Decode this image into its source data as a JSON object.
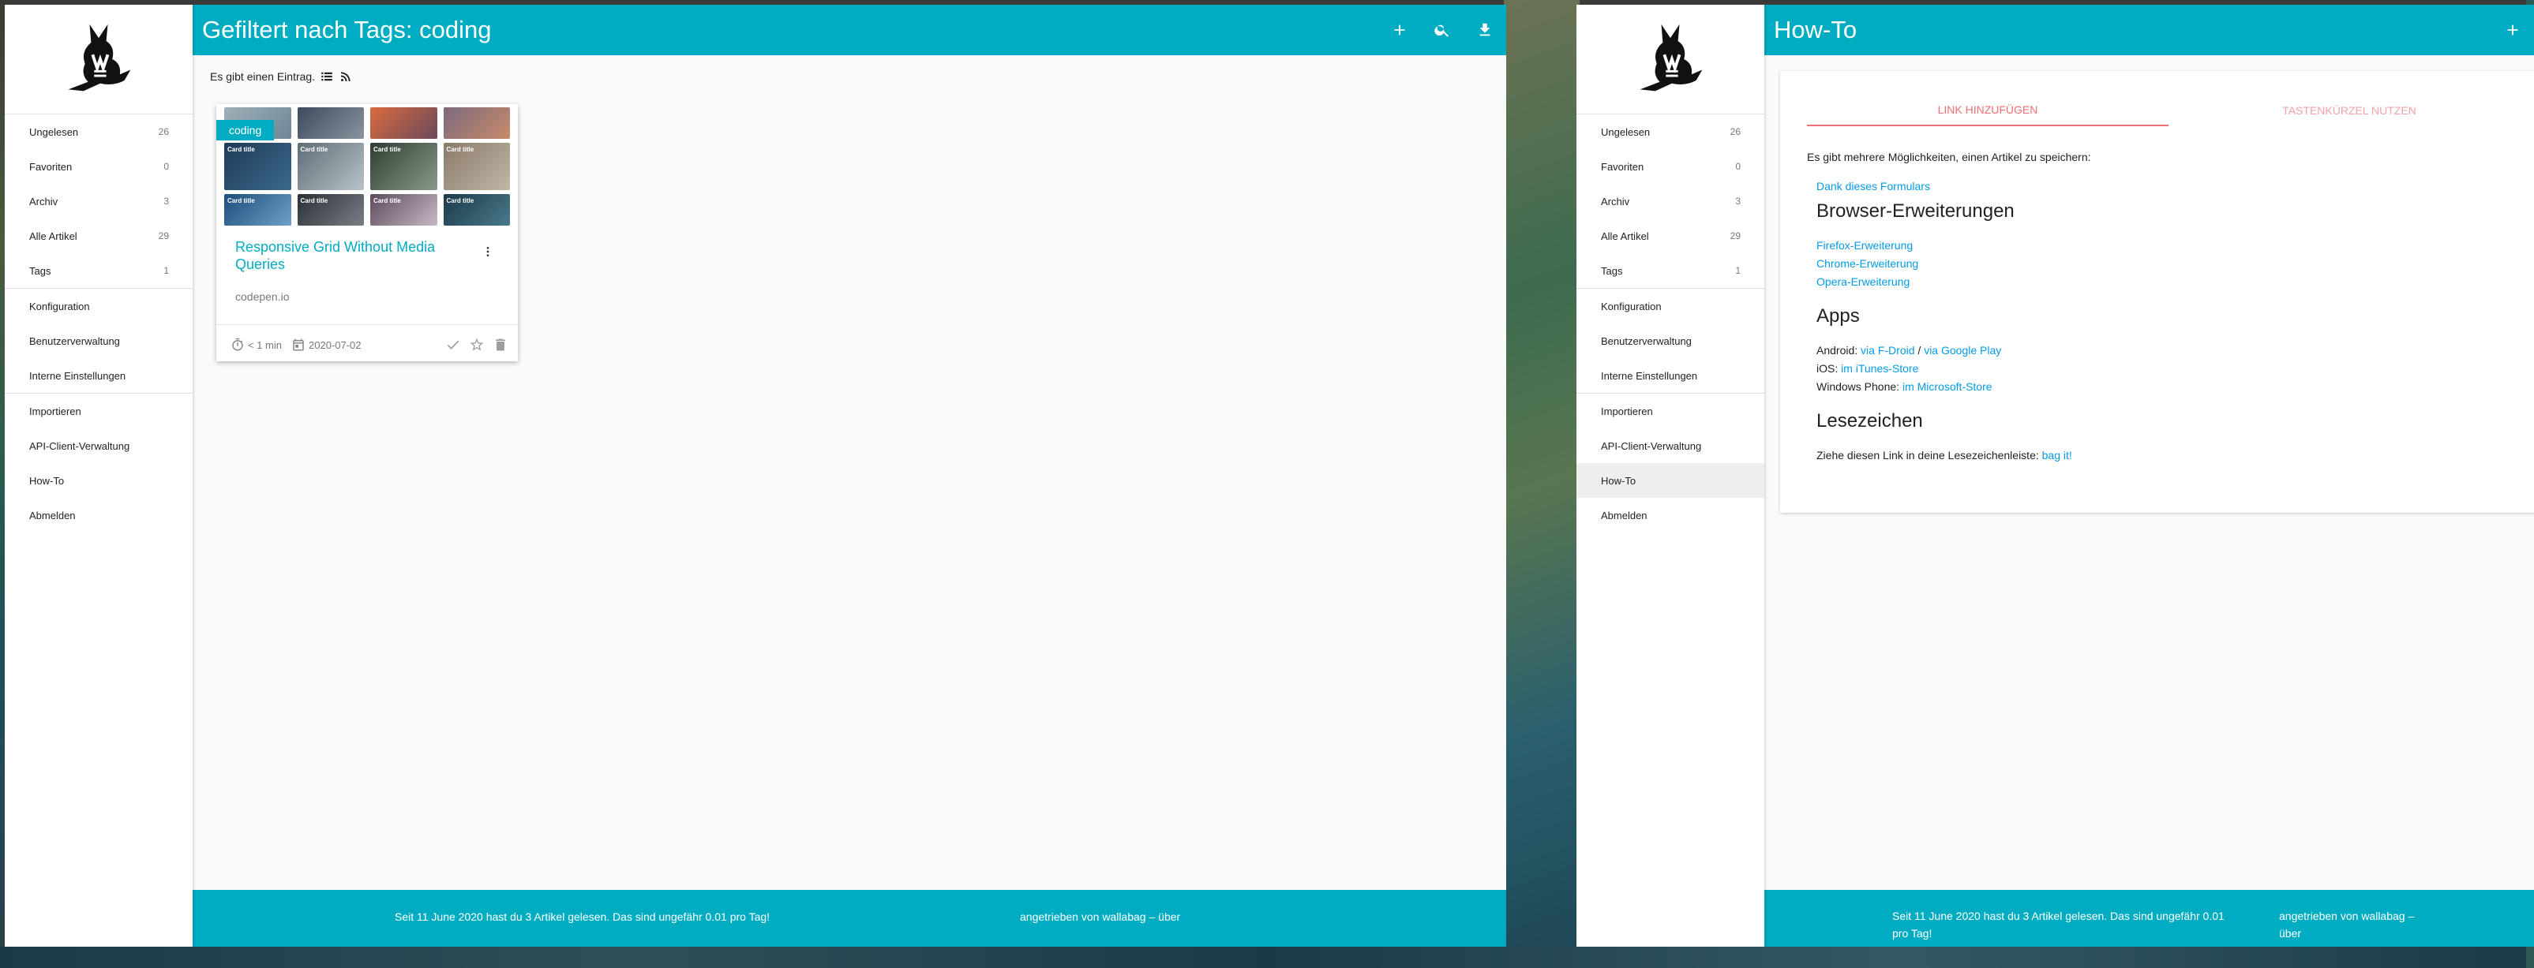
{
  "windows": [
    {
      "sidebar": {
        "items_main": [
          {
            "label": "Ungelesen",
            "count": "26"
          },
          {
            "label": "Favoriten",
            "count": "0"
          },
          {
            "label": "Archiv",
            "count": "3"
          },
          {
            "label": "Alle Artikel",
            "count": "29"
          },
          {
            "label": "Tags",
            "count": "1"
          }
        ],
        "items_config": [
          {
            "label": "Konfiguration"
          },
          {
            "label": "Benutzerverwaltung"
          },
          {
            "label": "Interne Einstellungen"
          }
        ],
        "items_other": [
          {
            "label": "Importieren"
          },
          {
            "label": "API-Client-Verwaltung"
          },
          {
            "label": "How-To"
          },
          {
            "label": "Abmelden"
          }
        ]
      },
      "topbar": {
        "title": "Gefiltert nach Tags: coding"
      },
      "entries_text": "Es gibt einen Eintrag.",
      "card": {
        "tag": "coding",
        "title": "Responsive Grid Without Media Queries",
        "domain": "codepen.io",
        "reading_time": "< 1 min",
        "date": "2020-07-02",
        "thumb_label": "Card title"
      },
      "footer": {
        "stats": "Seit 11 June 2020 hast du 3 Artikel gelesen. Das sind ungefähr 0.01 pro Tag!",
        "powered_prefix": "angetrieben von",
        "powered_link": "wallabag",
        "powered_sep": " – ",
        "about_link": "über"
      }
    },
    {
      "sidebar": {
        "items_main": [
          {
            "label": "Ungelesen",
            "count": "26"
          },
          {
            "label": "Favoriten",
            "count": "0"
          },
          {
            "label": "Archiv",
            "count": "3"
          },
          {
            "label": "Alle Artikel",
            "count": "29"
          },
          {
            "label": "Tags",
            "count": "1"
          }
        ],
        "items_config": [
          {
            "label": "Konfiguration"
          },
          {
            "label": "Benutzerverwaltung"
          },
          {
            "label": "Interne Einstellungen"
          }
        ],
        "items_other": [
          {
            "label": "Importieren"
          },
          {
            "label": "API-Client-Verwaltung"
          },
          {
            "label": "How-To"
          },
          {
            "label": "Abmelden"
          }
        ]
      },
      "topbar": {
        "title": "How-To"
      },
      "tabs": {
        "add_link": "Link hinzufügen",
        "shortcuts": "Tastenkürzel nutzen"
      },
      "howto": {
        "intro": "Es gibt mehrere Möglichkeiten, einen Artikel zu speichern:",
        "form_link": "Dank dieses Formulars",
        "browser_heading": "Browser-Erweiterungen",
        "firefox": "Firefox-Erweiterung",
        "chrome": "Chrome-Erweiterung",
        "opera": "Opera-Erweiterung",
        "apps_heading": "Apps",
        "android_label": "Android:",
        "android_fdroid": "via F-Droid",
        "android_sep": " / ",
        "android_play": "via Google Play",
        "ios_label": "iOS:",
        "ios_link": "im iTunes-Store",
        "wp_label": "Windows Phone:",
        "wp_link": "im Microsoft-Store",
        "bookmark_heading": "Lesezeichen",
        "bookmark_text": "Ziehe diesen Link in deine Lesezeichenleiste:",
        "bookmark_link": "bag it!"
      },
      "footer": {
        "stats": "Seit 11 June 2020 hast du 3 Artikel gelesen. Das sind ungefähr 0.01 pro Tag!",
        "powered_prefix": "angetrieben von",
        "powered_link": "wallabag",
        "powered_sep": " –",
        "about_link": "über"
      }
    }
  ],
  "colors": {
    "accent": "#00acc1",
    "link": "#039be5",
    "tab": "#ee6e73"
  }
}
